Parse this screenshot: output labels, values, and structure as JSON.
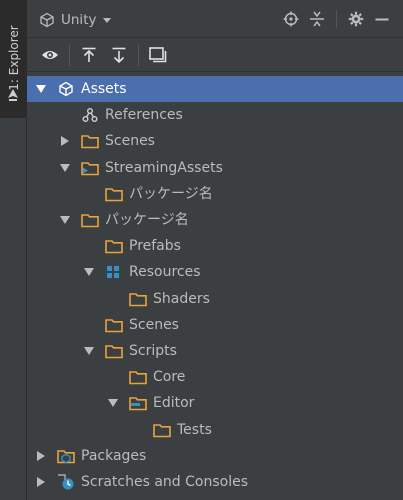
{
  "side_tab": {
    "label": "1: Explorer"
  },
  "header": {
    "project_name": "Unity"
  },
  "toolbar": {
    "buttons": [
      "eye-icon",
      "collapse-all-icon",
      "expand-all-icon",
      "preview-pane-icon"
    ]
  },
  "tree": {
    "items": [
      {
        "label": "Assets",
        "icon": "unity-icon",
        "arrow": "expanded",
        "selected": true
      },
      {
        "label": "References",
        "icon": "references-icon",
        "arrow": "none",
        "selected": false
      },
      {
        "label": "Scenes",
        "icon": "folder-icon",
        "arrow": "collapsed",
        "selected": false
      },
      {
        "label": "StreamingAssets",
        "icon": "streaming-folder-icon",
        "arrow": "expanded",
        "selected": false
      },
      {
        "label": "パッケージ名",
        "icon": "folder-icon",
        "arrow": "none",
        "selected": false
      },
      {
        "label": "パッケージ名",
        "icon": "folder-icon",
        "arrow": "expanded",
        "selected": false
      },
      {
        "label": "Prefabs",
        "icon": "folder-icon",
        "arrow": "none",
        "selected": false
      },
      {
        "label": "Resources",
        "icon": "resources-folder-icon",
        "arrow": "expanded",
        "selected": false
      },
      {
        "label": "Shaders",
        "icon": "folder-icon",
        "arrow": "none",
        "selected": false
      },
      {
        "label": "Scenes",
        "icon": "folder-icon",
        "arrow": "none",
        "selected": false
      },
      {
        "label": "Scripts",
        "icon": "folder-icon",
        "arrow": "expanded",
        "selected": false
      },
      {
        "label": "Core",
        "icon": "folder-icon",
        "arrow": "none",
        "selected": false
      },
      {
        "label": "Editor",
        "icon": "editor-folder-icon",
        "arrow": "expanded",
        "selected": false
      },
      {
        "label": "Tests",
        "icon": "folder-icon",
        "arrow": "none",
        "selected": false
      },
      {
        "label": "Packages",
        "icon": "packages-icon",
        "arrow": "collapsed",
        "selected": false
      },
      {
        "label": "Scratches and Consoles",
        "icon": "scratches-icon",
        "arrow": "collapsed",
        "selected": false
      }
    ]
  },
  "colors": {
    "background": "#3c3f41",
    "selection": "#4b6eaf",
    "folder": "#e8a33c",
    "accent_blue": "#3592c4",
    "text": "#bbbbbb"
  }
}
